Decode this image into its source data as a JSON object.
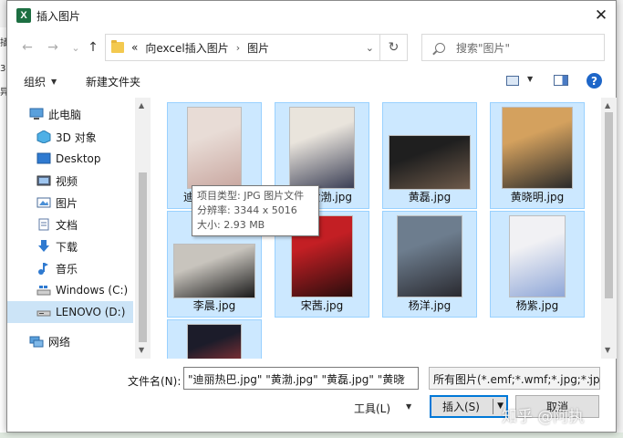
{
  "colors": {
    "accent": "#0078d7",
    "selection": "#cce8ff",
    "excel_green": "#1d6f42"
  },
  "window": {
    "title": "插入图片",
    "app_icon_letter": "X",
    "close_glyph": "✕"
  },
  "nav": {
    "back_glyph": "←",
    "forward_glyph": "→",
    "recent_glyph": "⌄",
    "up_glyph": "↑",
    "breadcrumb": {
      "overflow": "«",
      "parent": "向excel插入图片",
      "separator": "›",
      "current": "图片"
    },
    "dropdown_glyph": "⌄",
    "refresh_glyph": "↻",
    "search_placeholder": "搜索\"图片\""
  },
  "toolbar": {
    "organize": "组织",
    "new_folder": "新建文件夹",
    "help": "?"
  },
  "sidebar": {
    "items": [
      {
        "label": "此电脑",
        "icon": "computer-icon"
      },
      {
        "label": "3D 对象",
        "icon": "3d-objects-icon"
      },
      {
        "label": "Desktop",
        "icon": "desktop-icon"
      },
      {
        "label": "视频",
        "icon": "videos-icon"
      },
      {
        "label": "图片",
        "icon": "pictures-icon"
      },
      {
        "label": "文档",
        "icon": "documents-icon"
      },
      {
        "label": "下载",
        "icon": "downloads-icon"
      },
      {
        "label": "音乐",
        "icon": "music-icon"
      },
      {
        "label": "Windows (C:)",
        "icon": "windows-drive-icon"
      },
      {
        "label": "LENOVO (D:)",
        "icon": "drive-icon"
      },
      {
        "label": "网络",
        "icon": "network-icon"
      }
    ],
    "scroll_up": "▲",
    "scroll_down": "▼"
  },
  "files": [
    {
      "name": "迪",
      "thumb": [
        "#e8dcd6",
        "#c9a7a0"
      ]
    },
    {
      "name": "黄渤.jpg",
      "thumb": [
        "#e9e4dc",
        "#3b3f55"
      ]
    },
    {
      "name": "黄磊.jpg",
      "thumb": [
        "#1f1f1f",
        "#6e5a4a"
      ]
    },
    {
      "name": "黄晓明.jpg",
      "thumb": [
        "#d4a15e",
        "#2a2a2a"
      ]
    },
    {
      "name": "李晨.jpg",
      "thumb": [
        "#c8c4bd",
        "#1a1a1a"
      ]
    },
    {
      "name": "宋茜.jpg",
      "thumb": [
        "#c31f24",
        "#2a0d0d"
      ]
    },
    {
      "name": "杨洋.jpg",
      "thumb": [
        "#6d7d8e",
        "#2a2a30"
      ]
    },
    {
      "name": "杨紫.jpg",
      "thumb": [
        "#f1f1f4",
        "#8fa7d8"
      ]
    },
    {
      "name": "",
      "thumb": [
        "#1c1c2a",
        "#b33a3a"
      ]
    }
  ],
  "files_scroll": {
    "up": "▲",
    "down": "▼"
  },
  "tooltip": {
    "type": "项目类型: JPG 图片文件",
    "resolution": "分辨率: 3344 x 5016",
    "size": "大小: 2.93 MB"
  },
  "footer": {
    "filename_label": "文件名(N):",
    "filename_value": "\"迪丽热巴.jpg\" \"黄渤.jpg\" \"黄磊.jpg\" \"黄晓",
    "filetype_value": "所有图片(*.emf;*.wmf;*.jpg;*.jp",
    "dropdown_glyph": "⌄",
    "tools": "工具(L)",
    "insert": "插入(S)",
    "cancel": "取消"
  },
  "watermark": "知乎 @阿执",
  "background": {
    "edge_marks": [
      "插",
      "3D",
      "异"
    ]
  }
}
